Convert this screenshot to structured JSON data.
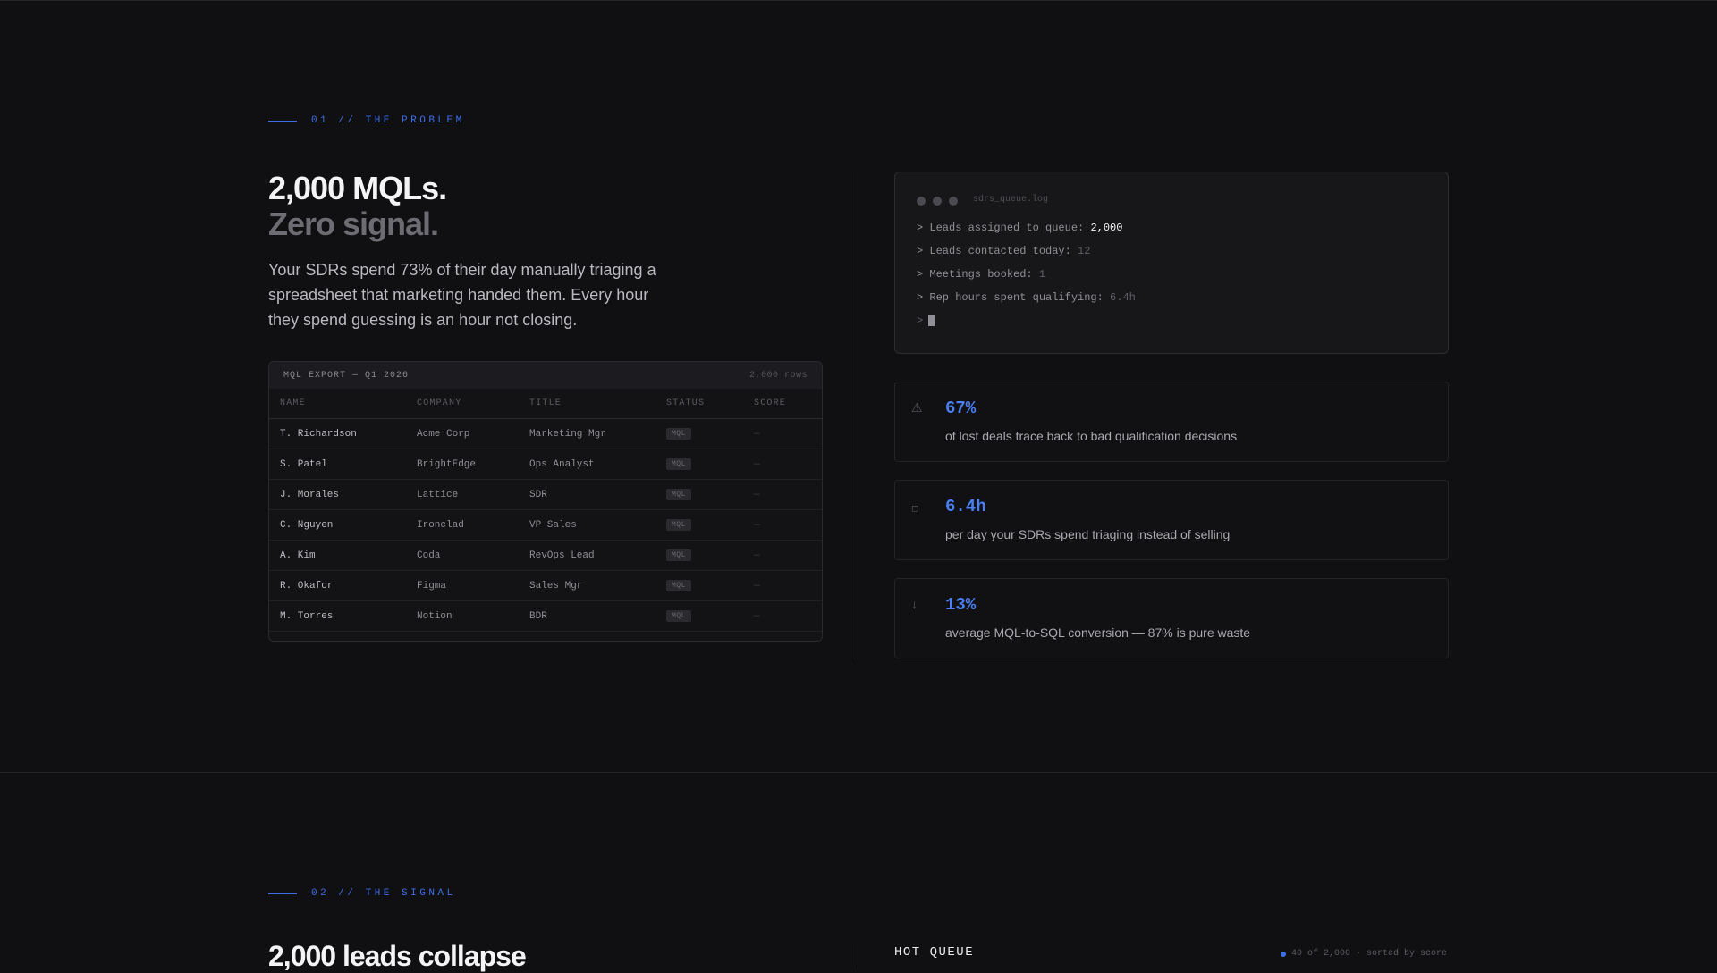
{
  "section1": {
    "eyebrow": "01 // THE PROBLEM",
    "headline": "2,000 MQLs.",
    "headline_muted": "Zero signal.",
    "lede": "Your SDRs spend 73% of their day manually triaging a spreadsheet that marketing handed them. Every hour they spend guessing is an hour not closing."
  },
  "table": {
    "title": "MQL EXPORT — Q1 2026",
    "rows_count": "2,000 rows",
    "columns": [
      "NAME",
      "COMPANY",
      "TITLE",
      "STATUS",
      "SCORE"
    ],
    "rows": [
      {
        "name": "T. Richardson",
        "company": "Acme Corp",
        "title": "Marketing Mgr",
        "status": "MQL",
        "score": "—"
      },
      {
        "name": "S. Patel",
        "company": "BrightEdge",
        "title": "Ops Analyst",
        "status": "MQL",
        "score": "—"
      },
      {
        "name": "J. Morales",
        "company": "Lattice",
        "title": "SDR",
        "status": "MQL",
        "score": "—"
      },
      {
        "name": "C. Nguyen",
        "company": "Ironclad",
        "title": "VP Sales",
        "status": "MQL",
        "score": "—"
      },
      {
        "name": "A. Kim",
        "company": "Coda",
        "title": "RevOps Lead",
        "status": "MQL",
        "score": "—"
      },
      {
        "name": "R. Okafor",
        "company": "Figma",
        "title": "Sales Mgr",
        "status": "MQL",
        "score": "—"
      },
      {
        "name": "M. Torres",
        "company": "Notion",
        "title": "BDR",
        "status": "MQL",
        "score": "—"
      }
    ]
  },
  "terminal": {
    "filename": "sdrs_queue.log",
    "lines": [
      {
        "label": "> Leads assigned to queue:",
        "value": "2,000"
      },
      {
        "label": "> Leads contacted today:",
        "value": "12"
      },
      {
        "label": "> Meetings booked:",
        "value": "1"
      },
      {
        "label": "> Rep hours spent qualifying:",
        "value": "6.4h"
      }
    ],
    "prompt": ">"
  },
  "stats": [
    {
      "icon": "warning-icon",
      "glyph": "⚠",
      "value": "67%",
      "desc": "of lost deals trace back to bad qualification decisions"
    },
    {
      "icon": "clock-icon",
      "glyph": "◻",
      "value": "6.4h",
      "desc": "per day your SDRs spend triaging instead of selling"
    },
    {
      "icon": "arrow-down-icon",
      "glyph": "↓",
      "value": "13%",
      "desc": "average MQL-to-SQL conversion — 87% is pure waste"
    }
  ],
  "section2": {
    "eyebrow": "02 // THE SIGNAL",
    "headline": "2,000 leads collapse",
    "queue_title": "HOT QUEUE",
    "queue_meta": "40 of 2,000 · sorted by score"
  },
  "colors": {
    "accent": "#3f6fe6",
    "stat_value": "#4a7ff5",
    "background": "#101013"
  }
}
